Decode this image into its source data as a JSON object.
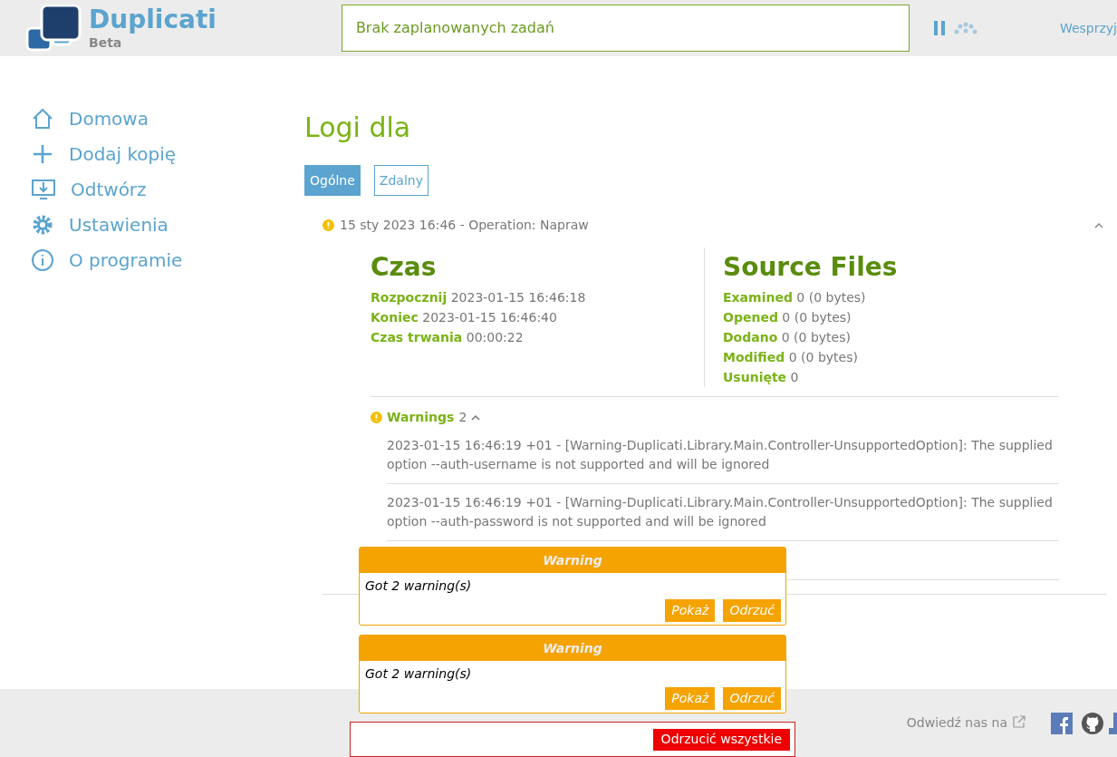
{
  "header": {
    "app_name": "Duplicati",
    "edition": "Beta",
    "status": "Brak zaplanowanych zadań",
    "donate_link": "Wesprzyj"
  },
  "sidebar": {
    "items": [
      {
        "label": "Domowa",
        "kind": "home"
      },
      {
        "label": "Dodaj kopię",
        "kind": "add"
      },
      {
        "label": "Odtwórz",
        "kind": "restore"
      },
      {
        "label": "Ustawienia",
        "kind": "settings"
      },
      {
        "label": "O programie",
        "kind": "about"
      }
    ]
  },
  "page_title": "Logi dla",
  "tabs": [
    {
      "label": "Ogólne",
      "selected": true
    },
    {
      "label": "Zdalny",
      "selected": false
    }
  ],
  "log_entry": {
    "title": "15 sty 2023 16:46 - Operation: Napraw",
    "expanded": true,
    "time_section": {
      "heading": "Czas",
      "rows": [
        {
          "label": "Rozpocznij",
          "value": "2023-01-15 16:46:18"
        },
        {
          "label": "Koniec",
          "value": "2023-01-15 16:46:40"
        },
        {
          "label": "Czas trwania",
          "value": "00:00:22"
        }
      ]
    },
    "files_section": {
      "heading": "Source Files",
      "rows": [
        {
          "label": "Examined",
          "value": "0 (0 bytes)"
        },
        {
          "label": "Opened",
          "value": "0 (0 bytes)"
        },
        {
          "label": "Dodano",
          "value": "0 (0 bytes)"
        },
        {
          "label": "Modified",
          "value": "0 (0 bytes)"
        },
        {
          "label": "Usunięte",
          "value": "0"
        }
      ]
    },
    "warnings": {
      "label": "Warnings",
      "count": "2",
      "expanded": true,
      "messages": [
        "2023-01-15 16:46:19 +01 - [Warning-Duplicati.Library.Main.Controller-UnsupportedOption]: The supplied option --auth-username is not supported and will be ignored",
        "2023-01-15 16:46:19 +01 - [Warning-Duplicati.Library.Main.Controller-UnsupportedOption]: The supplied option --auth-password is not supported and will be ignored"
      ]
    }
  },
  "footer": {
    "visit_text": "Odwiedź nas na"
  },
  "notifications": [
    {
      "title": "Warning",
      "message": "Got 2 warning(s)",
      "buttons": [
        "Pokaż",
        "Odrzuć"
      ]
    },
    {
      "title": "Warning",
      "message": "Got 2 warning(s)",
      "buttons": [
        "Pokaż",
        "Odrzuć"
      ]
    }
  ],
  "dismiss_all": "Odrzucić wszystkie"
}
